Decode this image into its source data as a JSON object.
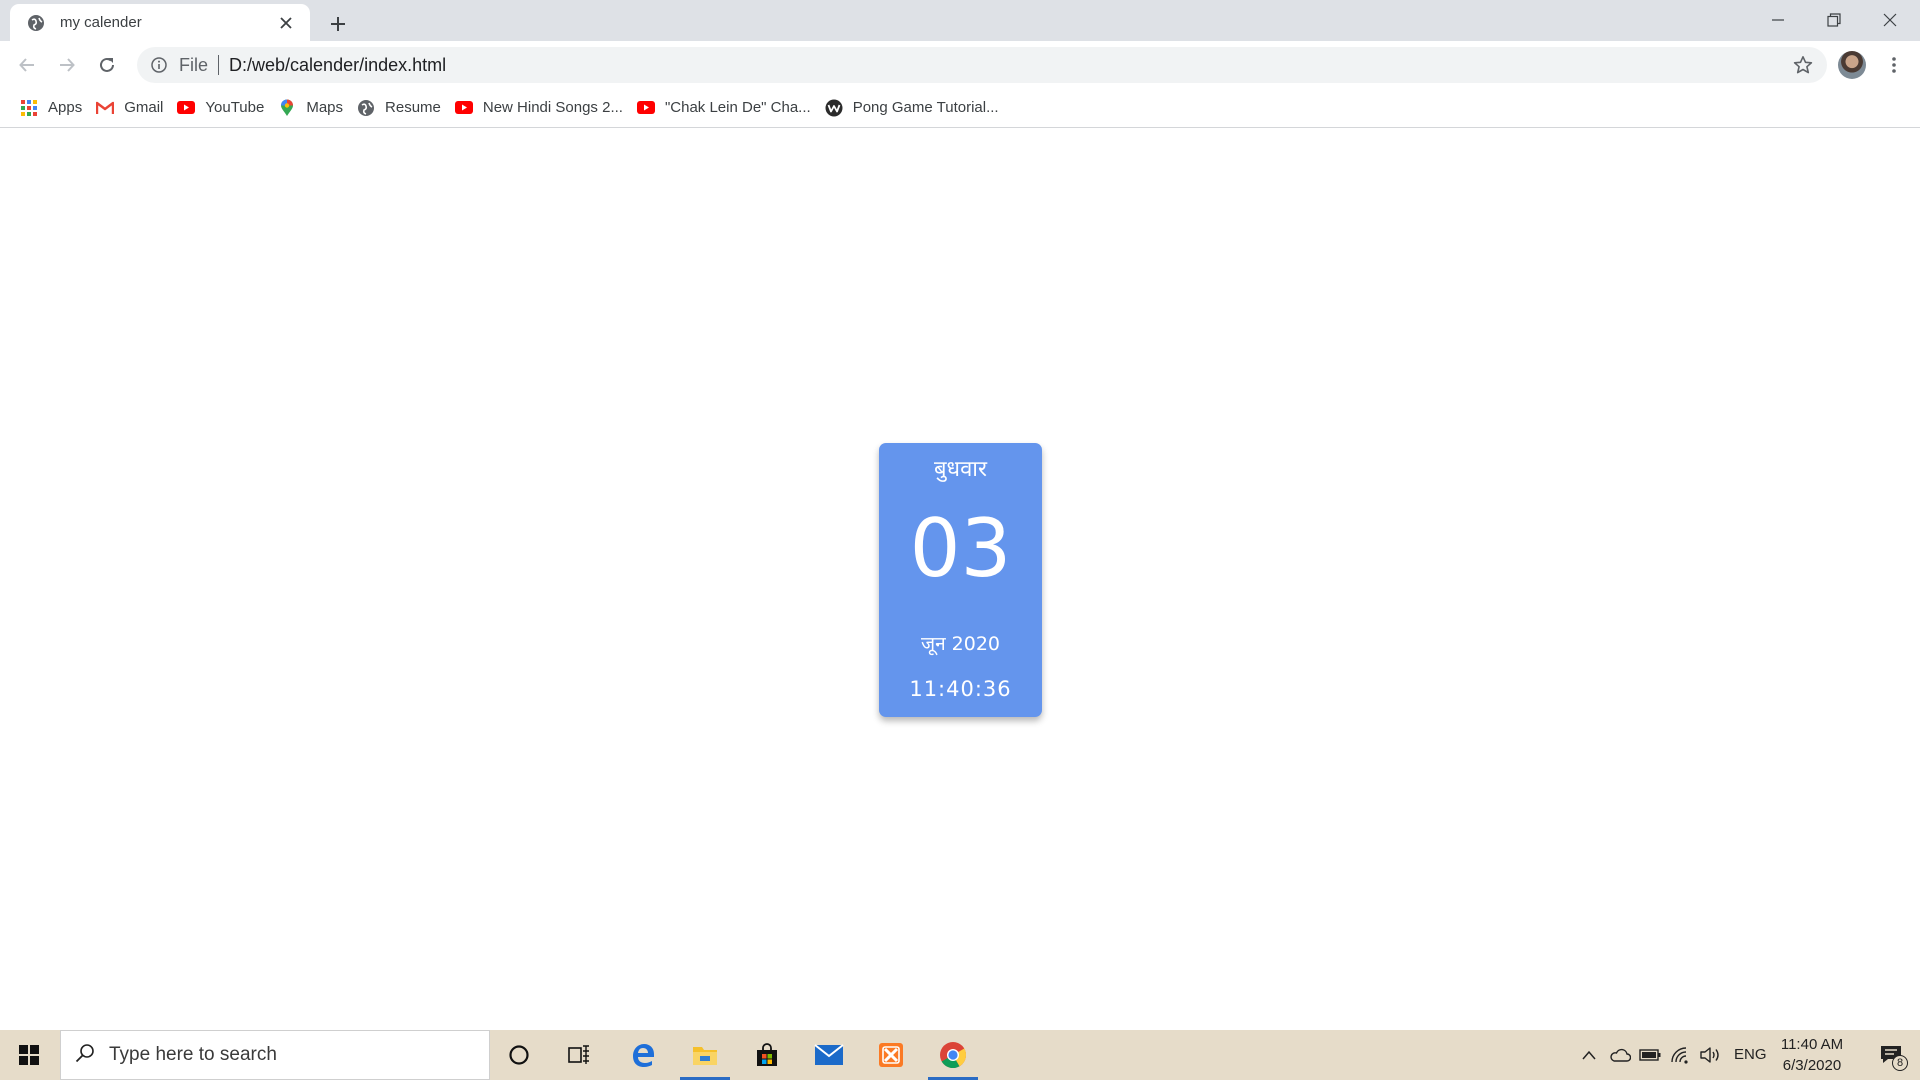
{
  "browser": {
    "tab_title": "my calender",
    "omnibox": {
      "scheme_label": "File",
      "url": "D:/web/calender/index.html"
    },
    "bookmarks": [
      {
        "label": "Apps",
        "icon": "apps-grid-icon"
      },
      {
        "label": "Gmail",
        "icon": "gmail-icon"
      },
      {
        "label": "YouTube",
        "icon": "youtube-icon"
      },
      {
        "label": "Maps",
        "icon": "maps-pin-icon"
      },
      {
        "label": "Resume",
        "icon": "globe-icon"
      },
      {
        "label": "New Hindi Songs 2...",
        "icon": "youtube-icon"
      },
      {
        "label": "\"Chak Lein De\" Cha...",
        "icon": "youtube-icon"
      },
      {
        "label": "Pong Game Tutorial...",
        "icon": "w-logo-icon"
      }
    ]
  },
  "calendar": {
    "day_name": "बुधवार",
    "date": "03",
    "month_year": "जून 2020",
    "time": "11:40:36",
    "card_color": "#6495ed"
  },
  "taskbar": {
    "search_placeholder": "Type here to search",
    "language": "ENG",
    "clock_time": "11:40 AM",
    "clock_date": "6/3/2020",
    "notification_count": "8",
    "background_color": "#e6dcc9"
  }
}
